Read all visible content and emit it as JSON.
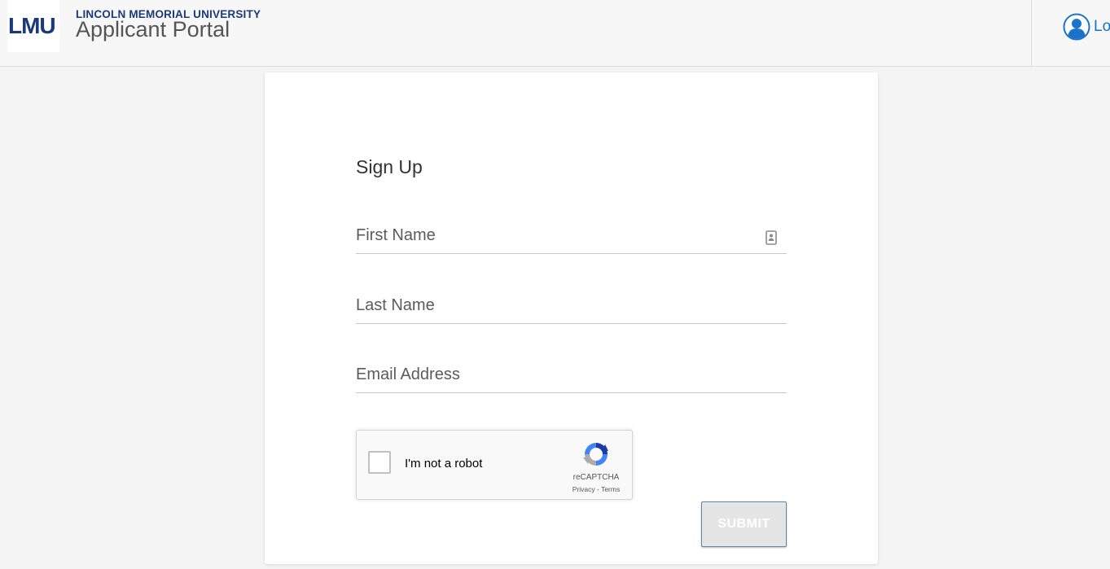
{
  "header": {
    "logo_text": "LMU",
    "university_name": "LINCOLN MEMORIAL UNIVERSITY",
    "portal_name": "Applicant Portal",
    "login_label": "Lo"
  },
  "form": {
    "title": "Sign Up",
    "fields": {
      "first_name": {
        "placeholder": "First Name",
        "value": ""
      },
      "last_name": {
        "placeholder": "Last Name",
        "value": ""
      },
      "email": {
        "placeholder": "Email Address",
        "value": ""
      }
    },
    "recaptcha": {
      "label": "I'm not a robot",
      "brand": "reCAPTCHA",
      "privacy": "Privacy",
      "separator": " - ",
      "terms": "Terms",
      "checked": false
    },
    "submit_label": "SUBMIT"
  },
  "colors": {
    "brand_navy": "#1b3a7a",
    "link_blue": "#1a73c9",
    "page_bg": "#f4f4f4"
  },
  "icons": [
    "user-icon",
    "autofill-icon",
    "recaptcha-logo-icon"
  ]
}
